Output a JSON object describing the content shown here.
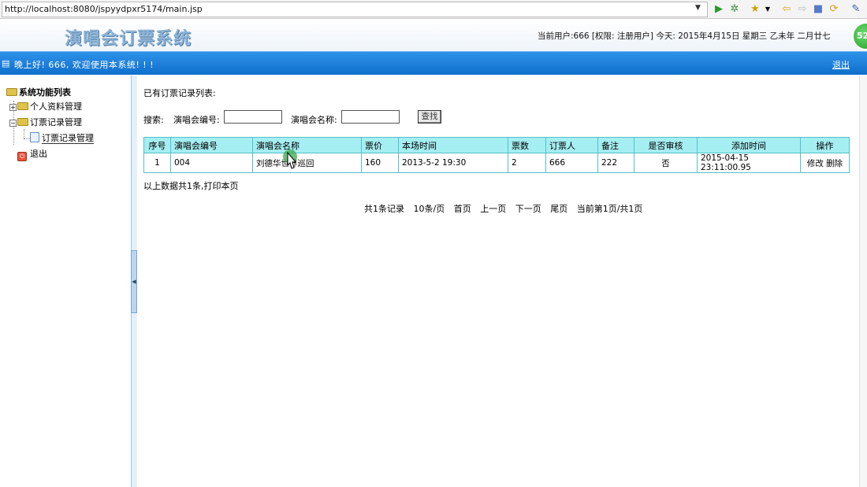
{
  "browser": {
    "url": "http://localhost:8080/jspyydpxr5174/main.jsp",
    "icons": [
      "dropdown-arrow-icon",
      "play-icon",
      "bug-icon",
      "star-icon",
      "back-icon",
      "forward-icon",
      "stop-icon",
      "refresh-icon",
      "tool-icon"
    ]
  },
  "header": {
    "title": "演唱会订票系统",
    "user_info": "当前用户:666 [权限: 注册用户] 今天:  2015年4月15日 星期三 乙未年 二月廿七",
    "badge": "52"
  },
  "welcome": {
    "text": "晚上好! 666, 欢迎使用本系统! ! !",
    "logout": "退出"
  },
  "sidebar": {
    "root": "系统功能列表",
    "items": [
      {
        "label": "个人资料管理"
      },
      {
        "label": "订票记录管理"
      },
      {
        "label": "订票记录管理"
      },
      {
        "label": "退出"
      }
    ]
  },
  "main": {
    "list_title": "已有订票记录列表:",
    "search": {
      "prefix": "搜索:",
      "label_code": "演唱会编号:",
      "label_name": "演唱会名称:",
      "button": "查找"
    },
    "table": {
      "headers": [
        "序号",
        "演唱会编号",
        "演唱会名称",
        "票价",
        "本场时间",
        "票数",
        "订票人",
        "备注",
        "是否审核",
        "添加时间",
        "操作"
      ],
      "rows": [
        {
          "no": "1",
          "code": "004",
          "name": "刘德华世界巡回",
          "price": "160",
          "time": "2013-5-2 19:30",
          "count": "2",
          "buyer": "666",
          "note": "222",
          "approved": "否",
          "added": "2015-04-15 23:11:00.95",
          "edit": "修改",
          "delete": "删除"
        }
      ]
    },
    "footer_note": "以上数据共1条,打印本页",
    "pager": {
      "total": "共1条记录",
      "per_page": "10条/页",
      "first": "首页",
      "prev": "上一页",
      "next": "下一页",
      "last": "尾页",
      "current": "当前第1页/共1页"
    }
  }
}
